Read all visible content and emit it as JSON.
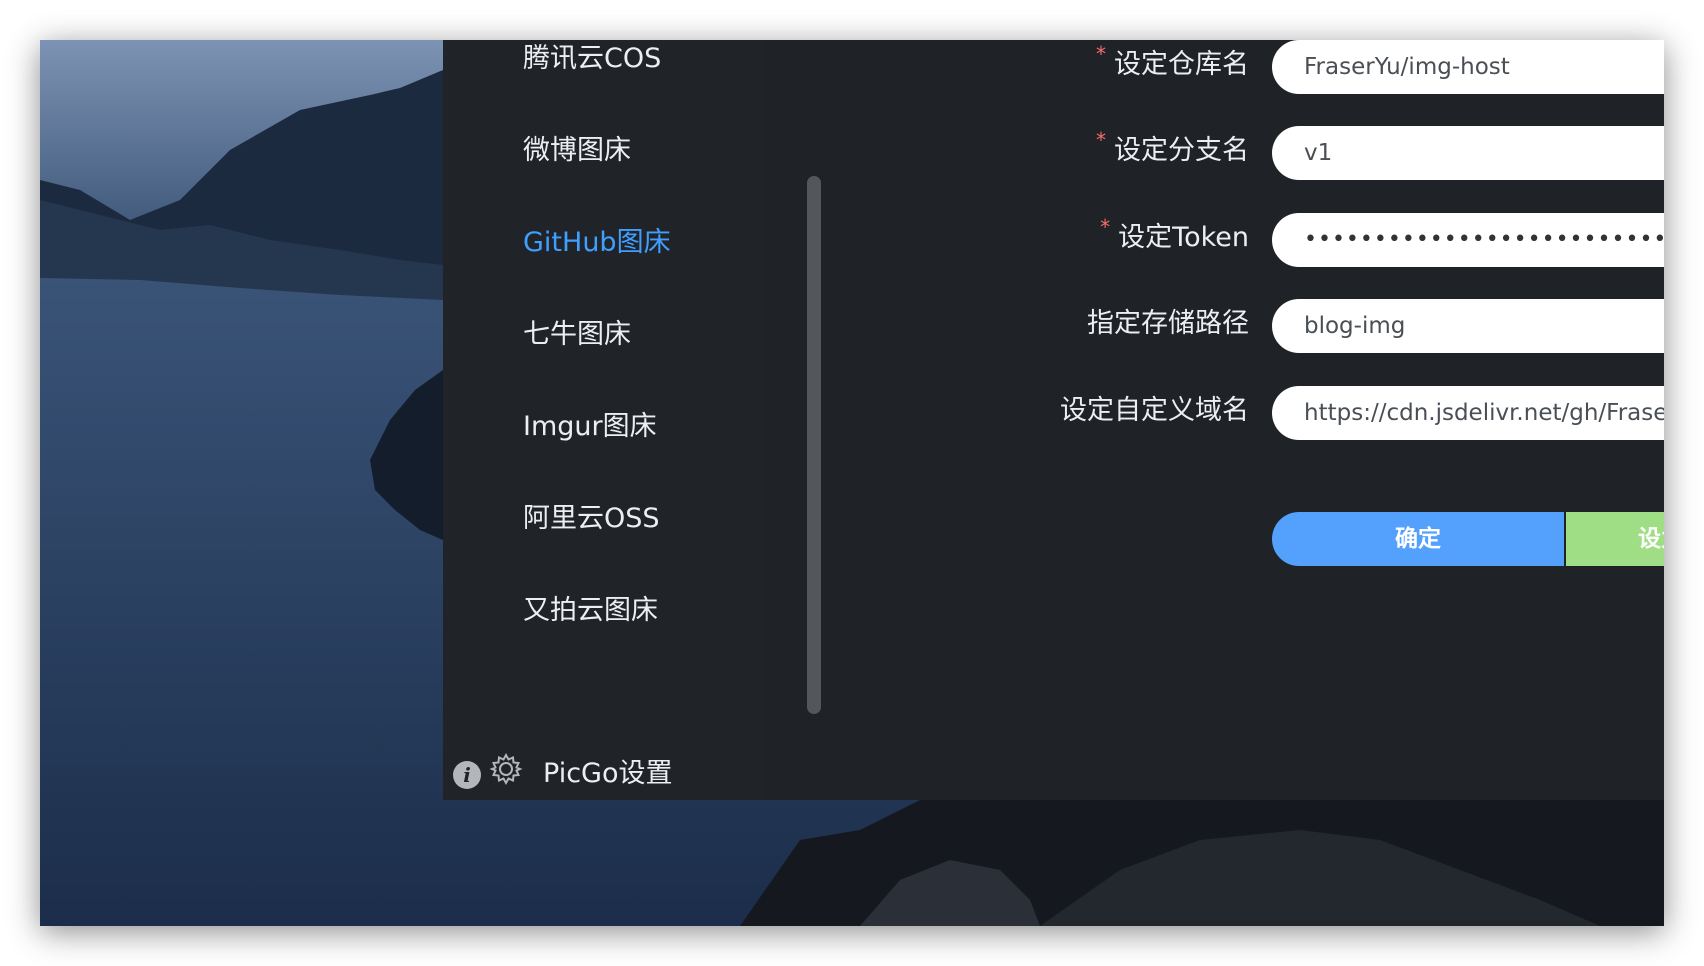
{
  "sidebar": {
    "items": [
      {
        "label": "腾讯云COS"
      },
      {
        "label": "微博图床"
      },
      {
        "label": "GitHub图床"
      },
      {
        "label": "七牛图床"
      },
      {
        "label": "Imgur图床"
      },
      {
        "label": "阿里云OSS"
      },
      {
        "label": "又拍云图床"
      }
    ],
    "active_item": "GitHub图床",
    "settings_label": "PicGo设置",
    "info_glyph": "i"
  },
  "form": {
    "repo": {
      "label": "设定仓库名",
      "required": true,
      "value": "FraserYu/img-host"
    },
    "branch": {
      "label": "设定分支名",
      "required": true,
      "value": "v1"
    },
    "token": {
      "label": "设定Token",
      "required": true,
      "value": "••••••••••••••••••••••••••••••••••••••••"
    },
    "path": {
      "label": "指定存储路径",
      "required": false,
      "value": "blog-img"
    },
    "domain": {
      "label": "设定自定义域名",
      "required": false,
      "value": "https://cdn.jsdelivr.net/gh/FraserYu/in"
    },
    "required_mark": "*",
    "confirm_label": "确定",
    "set_default_label": "设为默"
  },
  "icons": {
    "info": "info-icon",
    "settings": "gear-icon"
  },
  "colors": {
    "accent": "#409eff",
    "confirm": "#53a0fd",
    "default_btn": "#9fde84",
    "required": "#f56c6c",
    "app_bg": "#1f2327"
  }
}
